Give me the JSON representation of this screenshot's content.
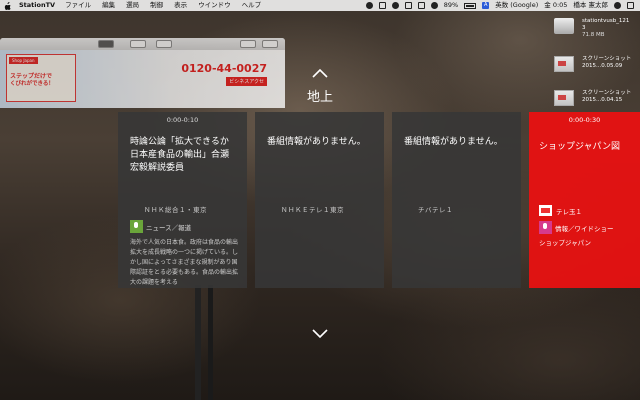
{
  "menubar": {
    "app_name": "StationTV",
    "menus": [
      "ファイル",
      "編集",
      "選局",
      "制御",
      "表示",
      "ウインドウ",
      "ヘルプ"
    ],
    "battery": "89%",
    "input_method": "英数 (Google)",
    "clock": "金 0:05",
    "user": "橋本 憲太郎"
  },
  "background_window": {
    "phone": "0120-44-0027",
    "phone_sub": "ビシネスアクセ",
    "ad_tag": "Shop Japan",
    "ad_line1": "ステップだけで",
    "ad_line2": "くびれができる！"
  },
  "desktop": [
    {
      "name": "stationtvusb_1213",
      "size": "71.8 MB"
    },
    {
      "name": "スクリーンショット 2015...0.05.09"
    },
    {
      "name": "スクリーンショット 2015...0.04.15"
    }
  ],
  "selector": {
    "band": "地上",
    "cards": [
      {
        "time": "0:00-0:10",
        "title": "時論公論「拡大できるか日本産食品の輸出」合瀬宏毅解説委員",
        "channel": "ＮＨＫ総合１・東京",
        "genre": "ニュース／報道",
        "description": "海外で人気の日本食。政府は食品の輸出拡大を成長戦略の一つに掲げている。しかし国によってさまざまな規制があり国際認証をとる必要もある。食品の輸出拡大の課題を考える"
      },
      {
        "time": "",
        "title": "番組情報がありません。",
        "channel": "ＮＨＫＥテレ１東京"
      },
      {
        "time": "",
        "title": "番組情報がありません。",
        "channel": "チバテレ１"
      },
      {
        "time": "0:00-0:30",
        "title": "ショップジャパン図",
        "channel": "テレ玉１",
        "genre": "情報／ワイドショー",
        "subtitle": "ショップジャパン"
      }
    ]
  }
}
